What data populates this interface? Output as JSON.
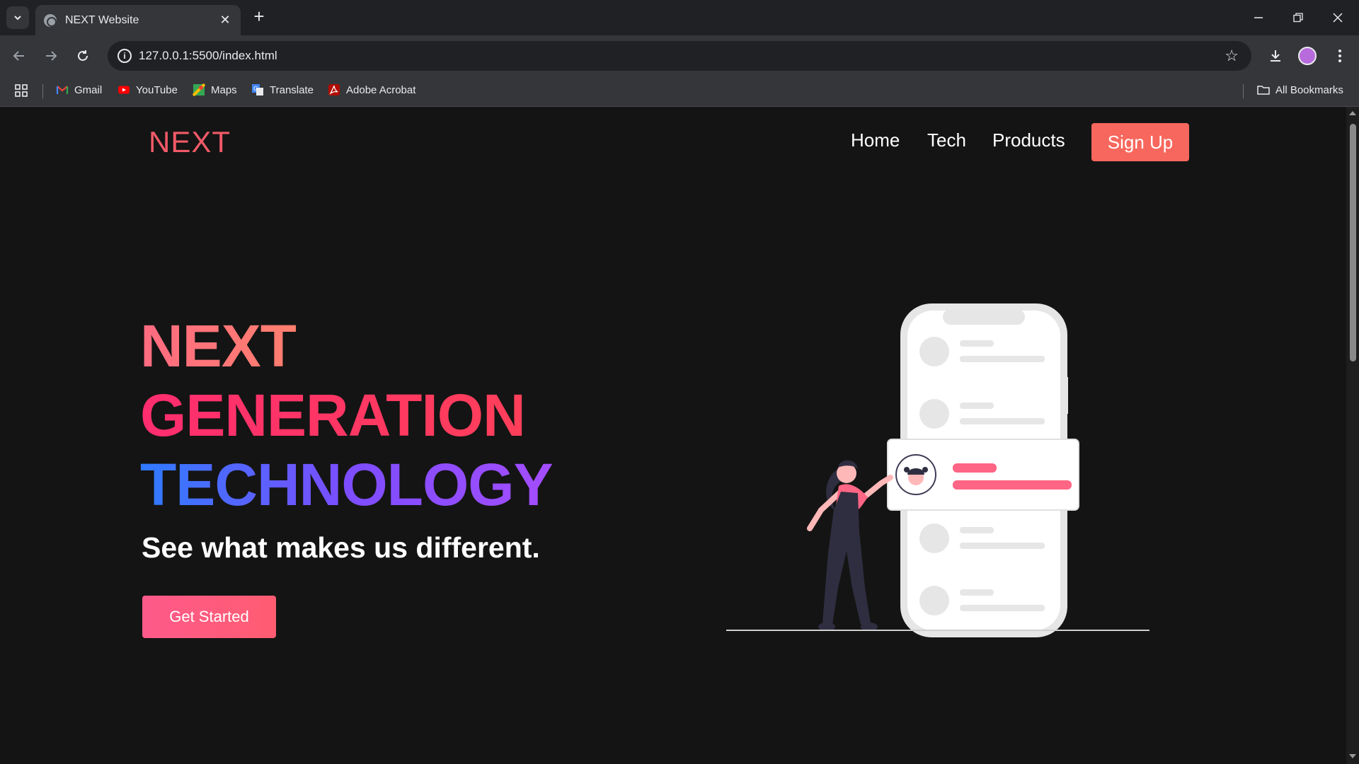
{
  "browser": {
    "tab_title": "NEXT Website",
    "url": "127.0.0.1:5500/index.html",
    "bookmarks": [
      {
        "label": "Gmail",
        "icon": "gmail-icon"
      },
      {
        "label": "YouTube",
        "icon": "youtube-icon"
      },
      {
        "label": "Maps",
        "icon": "maps-icon"
      },
      {
        "label": "Translate",
        "icon": "translate-icon"
      },
      {
        "label": "Adobe Acrobat",
        "icon": "acrobat-icon"
      }
    ],
    "all_bookmarks": "All Bookmarks"
  },
  "site": {
    "logo": "NEXT",
    "nav": [
      "Home",
      "Tech",
      "Products"
    ],
    "signup": "Sign Up",
    "hero": {
      "line1": "NEXT",
      "line2": "GENERATION",
      "line3": "TECHNOLOGY",
      "tagline": "See what makes us different.",
      "cta": "Get Started"
    }
  },
  "colors": {
    "accent": "#f7675d",
    "logo": "#f25a67",
    "background": "#141414"
  }
}
